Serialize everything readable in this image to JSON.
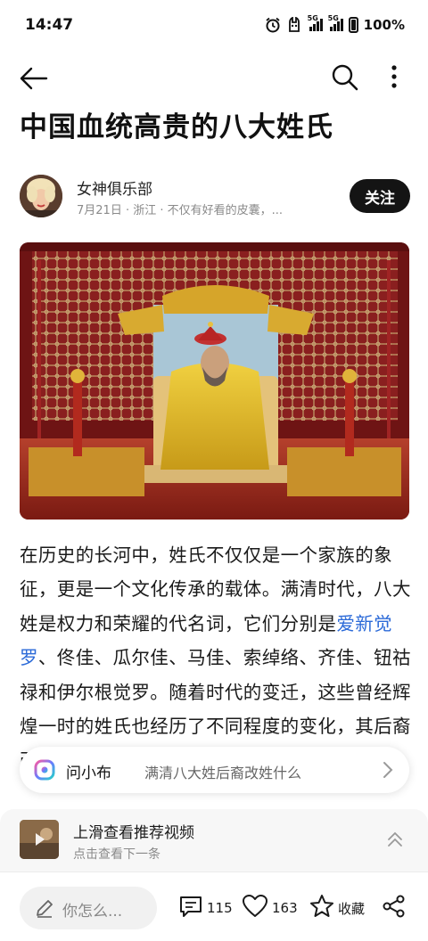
{
  "status_bar": {
    "time": "14:47",
    "network_label": "5G",
    "battery": "100%"
  },
  "article": {
    "title": "中国血统高贵的八大姓氏",
    "author": {
      "name": "女神俱乐部",
      "meta": "7月21日 · 浙江 · 不仅有好看的皮囊，...",
      "follow_label": "关注"
    },
    "hero_image": "Emperor in yellow robe seated on golden throne in red palace hall",
    "body": {
      "part1": "在历史的长河中，姓氏不仅仅是一个家族的象征，更是一个文化传承的载体。满清时代，八大姓是权力和荣耀的代名词，它们分别是",
      "link": "爱新觉罗",
      "part2": "、佟佳、瓜尔佳、马佳、索绰络、齐佳、钮祜禄和伊尔根觉罗。随着时代的变迁，这些曾经辉煌一时的姓氏也经历了不同程度的变化，其后裔改姓的现象也逐渐进入了人们的视野。"
    }
  },
  "ask_bar": {
    "name": "问小布",
    "query": "满清八大姓后裔改姓什么"
  },
  "recommend": {
    "title": "上滑查看推荐视频",
    "subtitle": "点击查看下一条"
  },
  "bottom_bar": {
    "comment_placeholder": "你怎么...",
    "comments": "115",
    "likes": "163",
    "favorite_label": "收藏"
  }
}
